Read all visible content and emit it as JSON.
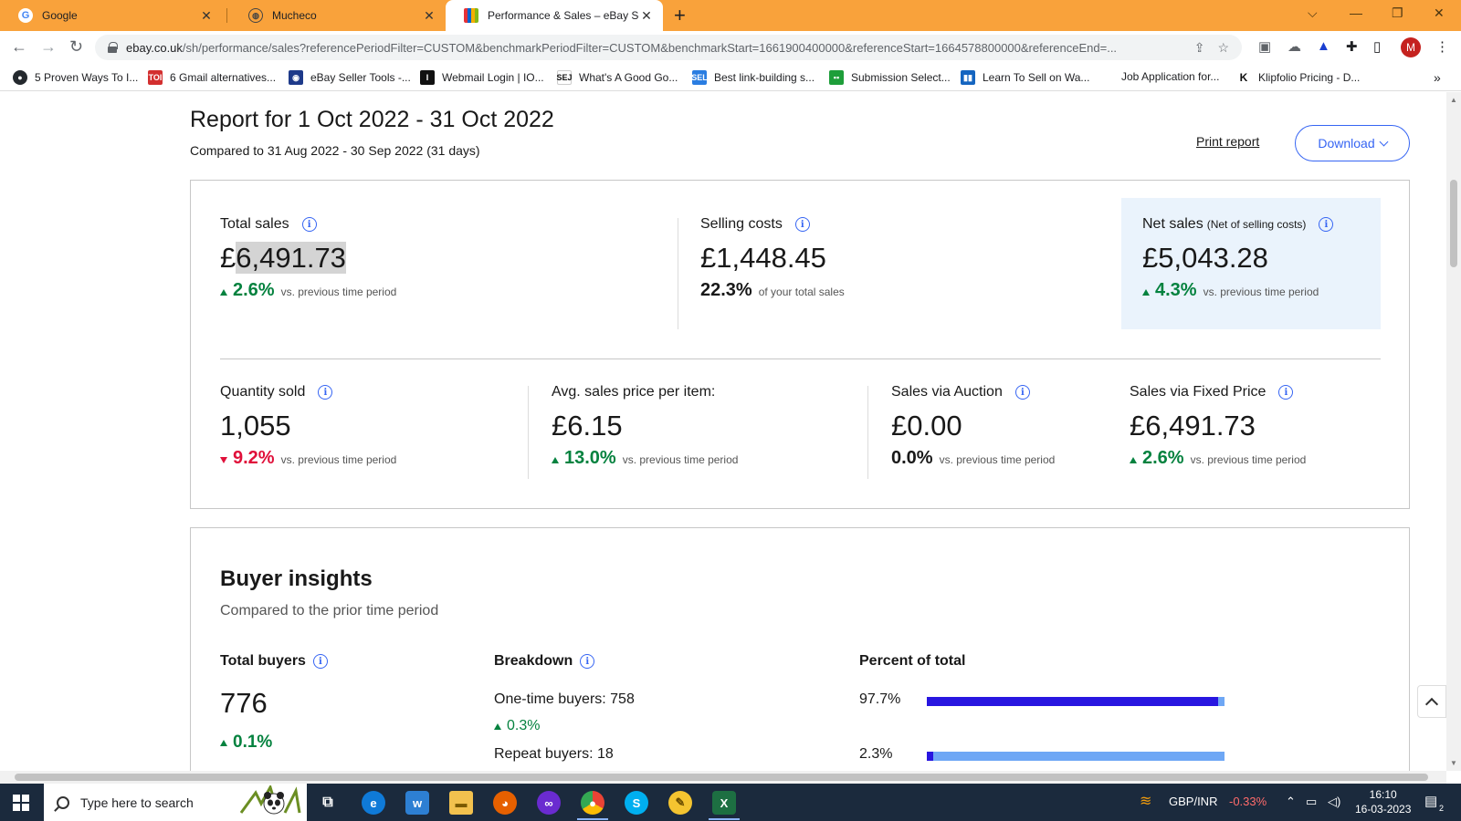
{
  "browser": {
    "tabs": [
      {
        "title": "Google",
        "icon": "google-icon"
      },
      {
        "title": "Mucheco",
        "icon": "globe-icon"
      },
      {
        "title": "Performance & Sales – eBay Selle",
        "icon": "ebay-bag-icon"
      }
    ],
    "url_host": "ebay.co.uk",
    "url_path": "/sh/performance/sales?referencePeriodFilter=CUSTOM&benchmarkPeriodFilter=CUSTOM&benchmarkStart=1661900400000&referenceStart=1664578800000&referenceEnd=...",
    "profile_initial": "M",
    "bookmarks": [
      {
        "label": "5 Proven Ways To I...",
        "icon": "github-icon",
        "color": "#24292e"
      },
      {
        "label": "6 Gmail alternatives...",
        "icon": "toi-icon",
        "color": "#d32f2f"
      },
      {
        "label": "eBay Seller Tools -...",
        "icon": "ebay-tools-icon",
        "color": "#1e3a8a"
      },
      {
        "label": "Webmail Login | IO...",
        "icon": "webmail-icon",
        "color": "#111111"
      },
      {
        "label": "What's A Good Go...",
        "icon": "sej-icon",
        "color": "#ffffff"
      },
      {
        "label": "Best link-building s...",
        "icon": "sel-icon",
        "color": "#2a7de1"
      },
      {
        "label": "Submission Select...",
        "icon": "submission-icon",
        "color": "#1e9e3a"
      },
      {
        "label": "Learn To Sell on Wa...",
        "icon": "chart-bars-icon",
        "color": "#1565c0"
      },
      {
        "label": "Job Application for...",
        "icon": "",
        "color": ""
      },
      {
        "label": "Klipfolio Pricing - D...",
        "icon": "klipfolio-icon",
        "color": "#111111"
      }
    ],
    "bookmarks_more": "»"
  },
  "report": {
    "title": "Report for 1 Oct 2022 - 31 Oct 2022",
    "subtitle": "Compared to 31 Aug 2022 - 30 Sep 2022 (31 days)",
    "print_label": "Print report",
    "download_label": "Download"
  },
  "metrics": {
    "total_sales": {
      "label": "Total sales",
      "currency": "£",
      "amount": "6,491.73",
      "change": "2.6%",
      "direction": "up",
      "comparison": "vs. previous time period"
    },
    "selling_costs": {
      "label": "Selling costs",
      "value": "£1,448.45",
      "change": "22.3%",
      "comparison": "of your total sales"
    },
    "net_sales": {
      "label": "Net sales",
      "label_note": "(Net of selling costs)",
      "value": "£5,043.28",
      "change": "4.3%",
      "direction": "up",
      "comparison": "vs. previous time period"
    },
    "quantity_sold": {
      "label": "Quantity sold",
      "value": "1,055",
      "change": "9.2%",
      "direction": "down",
      "comparison": "vs. previous time period"
    },
    "avg_price": {
      "label": "Avg. sales price per item:",
      "value": "£6.15",
      "change": "13.0%",
      "direction": "up",
      "comparison": "vs. previous time period"
    },
    "auction": {
      "label": "Sales via Auction",
      "value": "£0.00",
      "change": "0.0%",
      "direction": "neutral",
      "comparison": "vs. previous time period"
    },
    "fixed_price": {
      "label": "Sales via Fixed Price",
      "value": "£6,491.73",
      "change": "2.6%",
      "direction": "up",
      "comparison": "vs. previous time period"
    }
  },
  "buyer_insights": {
    "title": "Buyer insights",
    "subtitle": "Compared to the prior time period",
    "total_buyers_heading": "Total buyers",
    "breakdown_heading": "Breakdown",
    "percent_heading": "Percent of total",
    "total_buyers_value": "776",
    "total_buyers_change": "0.1%",
    "one_time_label": "One-time buyers: 758",
    "one_time_change": "0.3%",
    "repeat_label": "Repeat buyers: 18",
    "one_time_percent": "97.7%",
    "one_time_percent_value": 97.7,
    "repeat_percent": "2.3%",
    "repeat_percent_value": 2.3,
    "bar_color": "#2816e0",
    "bar_track_color": "#6ea7f5"
  },
  "colors": {
    "tab_bar": "#f9a23b",
    "positive": "#05823f",
    "negative": "#e0103a",
    "link_blue": "#3665f3",
    "net_box": "#eaf3fc"
  },
  "taskbar": {
    "search_placeholder": "Type here to search",
    "currency_pair": "GBP/INR",
    "currency_change": "-0.33%",
    "time": "16:10",
    "date": "16-03-2023",
    "notification_count": "2"
  }
}
